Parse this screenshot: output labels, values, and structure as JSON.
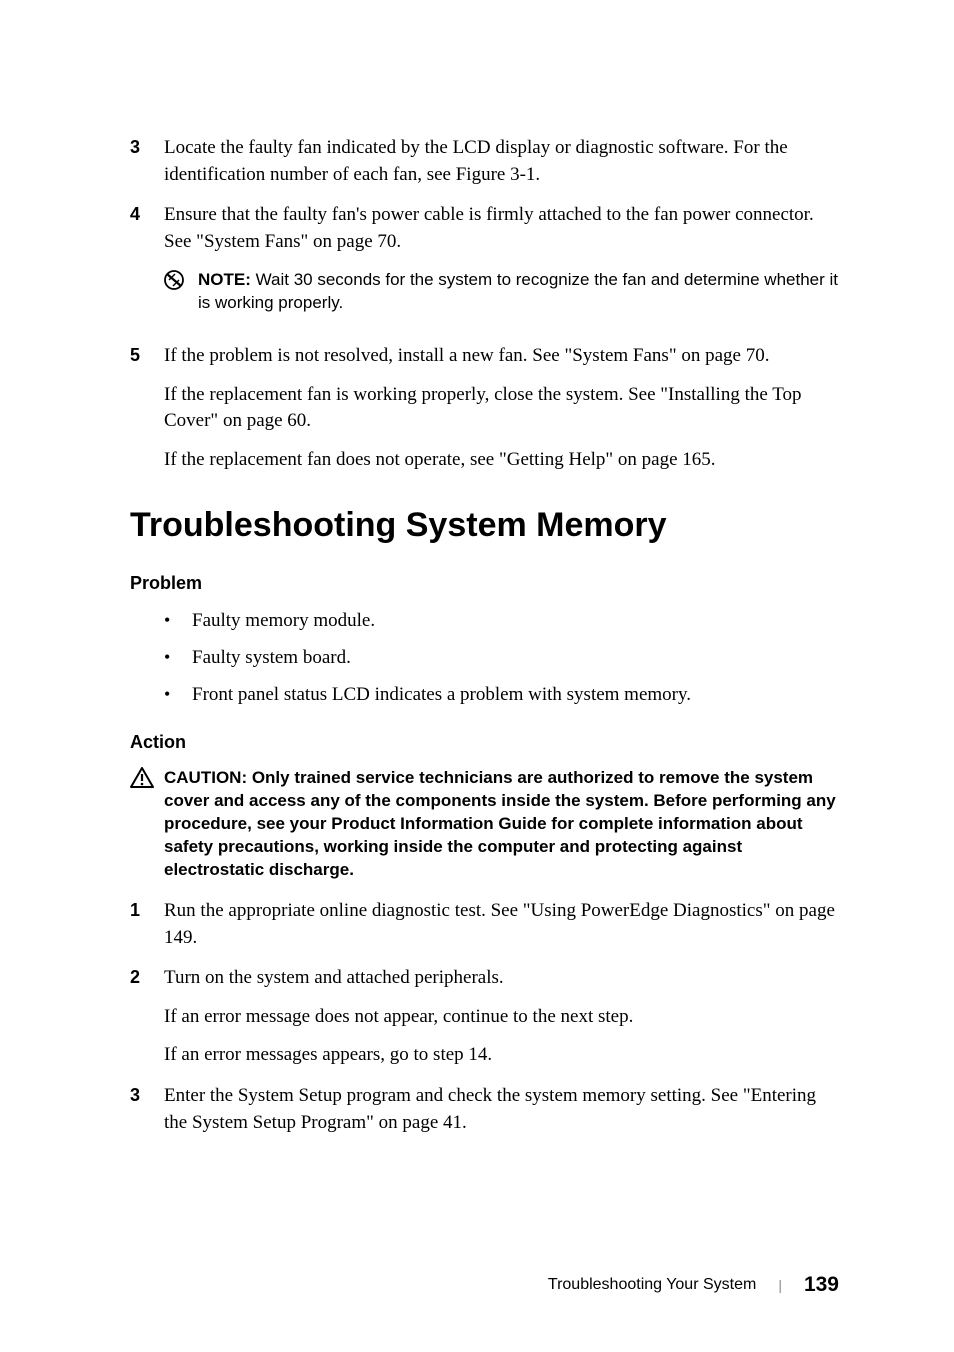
{
  "steps_top": {
    "s3": {
      "marker": "3",
      "text": "Locate the faulty fan indicated by the LCD display or diagnostic software. For the identification number of each fan, see Figure 3-1."
    },
    "s4": {
      "marker": "4",
      "text": "Ensure that the faulty fan's power cable is firmly attached to the fan power connector. See \"System Fans\" on page 70."
    },
    "note": {
      "label": "NOTE:",
      "text": " Wait 30 seconds for the system to recognize the fan and determine whether it is working properly."
    },
    "s5": {
      "marker": "5",
      "text": "If the problem is not resolved, install a new fan. See \"System Fans\" on page 70.",
      "p2": "If the replacement fan is working properly, close the system. See \"Installing the Top Cover\" on page 60.",
      "p3": "If the replacement fan does not operate, see \"Getting Help\" on page 165."
    }
  },
  "heading": "Troubleshooting System Memory",
  "problem": {
    "label": "Problem",
    "b1": "Faulty memory module.",
    "b2": "Faulty system board.",
    "b3": "Front panel status LCD indicates a problem with system memory."
  },
  "action": {
    "label": "Action",
    "caution": {
      "label": "CAUTION: ",
      "text": "Only trained service technicians are authorized to remove the system cover and access any of the components inside the system. Before performing any procedure, see your Product Information Guide for complete information about safety precautions, working inside the computer and protecting against electrostatic discharge."
    },
    "s1": {
      "marker": "1",
      "text": "Run the appropriate online diagnostic test. See \"Using PowerEdge Diagnostics\" on page 149."
    },
    "s2": {
      "marker": "2",
      "text": "Turn on the system and attached peripherals.",
      "p2": "If an error message does not appear, continue to the next step.",
      "p3": "If an error messages appears, go to step 14."
    },
    "s3": {
      "marker": "3",
      "text": "Enter the System Setup program and check the system memory setting. See \"Entering the System Setup Program\" on page 41."
    }
  },
  "footer": {
    "title": "Troubleshooting Your System",
    "page": "139"
  }
}
